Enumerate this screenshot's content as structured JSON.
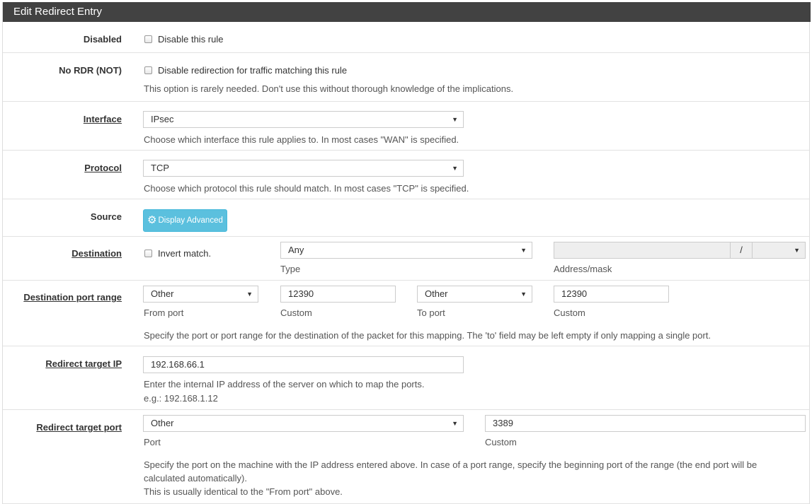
{
  "panel": {
    "title": "Edit Redirect Entry"
  },
  "disabled": {
    "label": "Disabled",
    "checkbox_label": "Disable this rule"
  },
  "nordr": {
    "label": "No RDR (NOT)",
    "checkbox_label": "Disable redirection for traffic matching this rule",
    "help": "This option is rarely needed. Don't use this without thorough knowledge of the implications."
  },
  "interface": {
    "label": "Interface",
    "value": "IPsec",
    "help": "Choose which interface this rule applies to. In most cases \"WAN\" is specified."
  },
  "protocol": {
    "label": "Protocol",
    "value": "TCP",
    "help": "Choose which protocol this rule should match. In most cases \"TCP\" is specified."
  },
  "source": {
    "label": "Source",
    "button": "Display Advanced",
    "button_icon": "gear-icon"
  },
  "destination": {
    "label": "Destination",
    "invert_label": "Invert match.",
    "type_value": "Any",
    "type_caption": "Type",
    "address_value": "",
    "mask_sep": "/",
    "mask_value": "",
    "address_caption": "Address/mask"
  },
  "dest_port_range": {
    "label": "Destination port range",
    "from_value": "Other",
    "from_caption": "From port",
    "from_custom": "12390",
    "from_custom_caption": "Custom",
    "to_value": "Other",
    "to_caption": "To port",
    "to_custom": "12390",
    "to_custom_caption": "Custom",
    "help": "Specify the port or port range for the destination of the packet for this mapping. The 'to' field may be left empty if only mapping a single port."
  },
  "redirect_ip": {
    "label": "Redirect target IP",
    "value": "192.168.66.1",
    "help1": "Enter the internal IP address of the server on which to map the ports.",
    "help2": "e.g.: 192.168.1.12"
  },
  "redirect_port": {
    "label": "Redirect target port",
    "port_value": "Other",
    "port_caption": "Port",
    "custom_value": "3389",
    "custom_caption": "Custom",
    "help1": "Specify the port on the machine with the IP address entered above. In case of a port range, specify the beginning port of the range (the end port will be",
    "help2": "calculated automatically).",
    "help3": "This is usually identical to the \"From port\" above."
  }
}
